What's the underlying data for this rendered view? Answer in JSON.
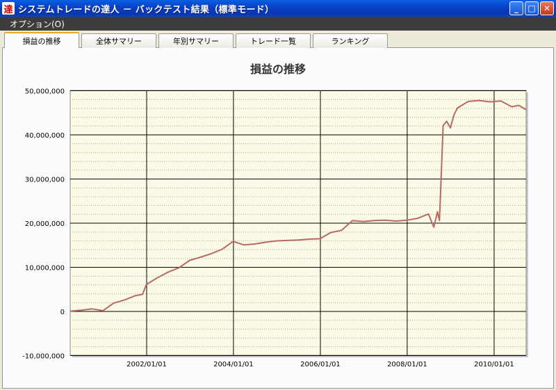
{
  "window": {
    "icon_char": "達",
    "title": "システムトレードの達人 － バックテスト結果（標準モード）",
    "min_label": "_",
    "max_label": "□",
    "close_label": "✕"
  },
  "menu": {
    "options_label": "オプション(O)"
  },
  "tabs": [
    {
      "label": "損益の推移",
      "active": true
    },
    {
      "label": "全体サマリー",
      "active": false
    },
    {
      "label": "年別サマリー",
      "active": false
    },
    {
      "label": "トレード一覧",
      "active": false
    },
    {
      "label": "ランキング",
      "active": false
    }
  ],
  "chart_data": {
    "type": "line",
    "title": "損益の推移",
    "xlabel": "",
    "ylabel": "",
    "ylim": [
      -10000000,
      50000000
    ],
    "xlim": [
      "2000-04-01",
      "2010-09-30"
    ],
    "y_ticks": [
      "50,000,000",
      "40,000,000",
      "30,000,000",
      "20,000,000",
      "10,000,000",
      "0",
      "-10,000,000"
    ],
    "x_ticks": [
      "2002/01/01",
      "2004/01/01",
      "2006/01/01",
      "2008/01/01",
      "2010/01/01"
    ],
    "grid": true,
    "colors": {
      "plot_bg": "#fafae6",
      "line": "#b86a62",
      "major_grid": "#000000",
      "minor_grid": "#a8a890"
    },
    "series": [
      {
        "values": [
          [
            "2000-04-01",
            0
          ],
          [
            "2000-07-01",
            200000
          ],
          [
            "2000-10-01",
            500000
          ],
          [
            "2001-01-01",
            100000
          ],
          [
            "2001-04-01",
            1800000
          ],
          [
            "2001-07-01",
            2500000
          ],
          [
            "2001-10-01",
            3500000
          ],
          [
            "2001-12-01",
            3800000
          ],
          [
            "2002-01-01",
            6000000
          ],
          [
            "2002-04-01",
            7500000
          ],
          [
            "2002-07-01",
            8800000
          ],
          [
            "2002-10-01",
            9800000
          ],
          [
            "2003-01-01",
            11500000
          ],
          [
            "2003-04-01",
            12200000
          ],
          [
            "2003-07-01",
            13000000
          ],
          [
            "2003-10-01",
            14000000
          ],
          [
            "2004-01-01",
            15800000
          ],
          [
            "2004-04-01",
            15000000
          ],
          [
            "2004-07-01",
            15200000
          ],
          [
            "2004-10-01",
            15600000
          ],
          [
            "2005-01-01",
            15900000
          ],
          [
            "2005-04-01",
            16000000
          ],
          [
            "2005-07-01",
            16100000
          ],
          [
            "2005-10-01",
            16300000
          ],
          [
            "2006-01-01",
            16400000
          ],
          [
            "2006-04-01",
            17800000
          ],
          [
            "2006-07-01",
            18300000
          ],
          [
            "2006-10-01",
            20500000
          ],
          [
            "2007-01-01",
            20300000
          ],
          [
            "2007-04-01",
            20500000
          ],
          [
            "2007-07-01",
            20600000
          ],
          [
            "2007-10-01",
            20400000
          ],
          [
            "2008-01-01",
            20600000
          ],
          [
            "2008-04-01",
            21000000
          ],
          [
            "2008-07-01",
            22000000
          ],
          [
            "2008-08-15",
            19000000
          ],
          [
            "2008-09-15",
            22500000
          ],
          [
            "2008-10-01",
            20500000
          ],
          [
            "2008-10-15",
            30000000
          ],
          [
            "2008-11-01",
            42000000
          ],
          [
            "2008-12-01",
            43000000
          ],
          [
            "2009-01-01",
            41500000
          ],
          [
            "2009-02-01",
            44500000
          ],
          [
            "2009-03-01",
            46000000
          ],
          [
            "2009-06-01",
            47500000
          ],
          [
            "2009-09-01",
            47700000
          ],
          [
            "2009-12-01",
            47400000
          ],
          [
            "2010-03-01",
            47600000
          ],
          [
            "2010-06-01",
            46300000
          ],
          [
            "2010-08-01",
            46600000
          ],
          [
            "2010-09-30",
            45600000
          ]
        ]
      }
    ]
  }
}
